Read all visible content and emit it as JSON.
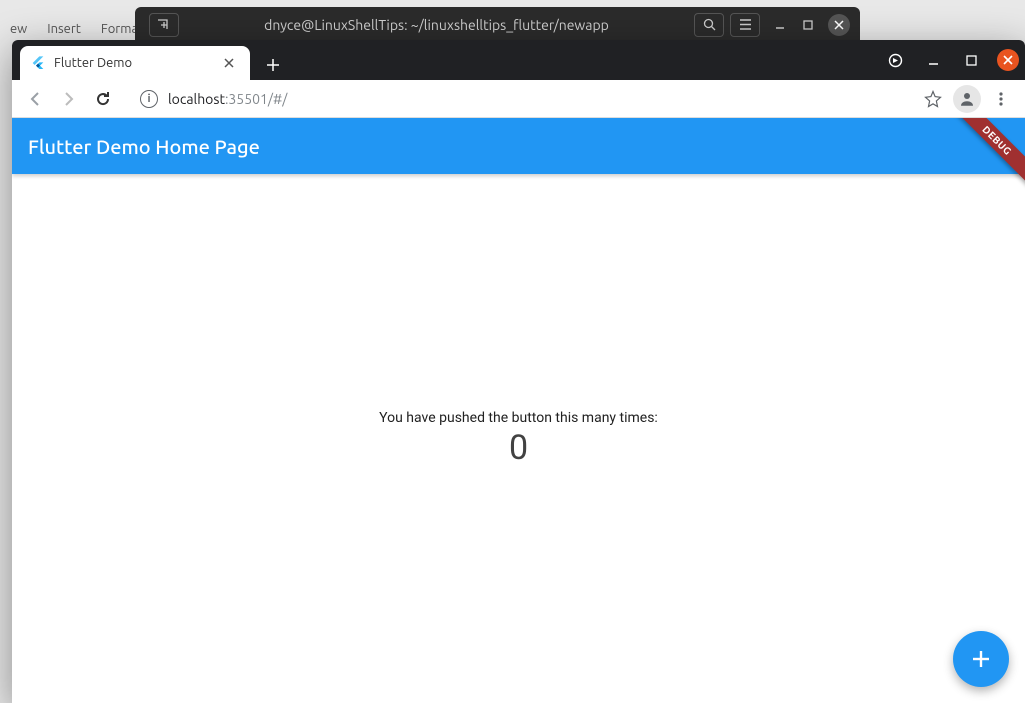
{
  "desktop": {
    "menus": [
      "ew",
      "Insert",
      "Forma"
    ]
  },
  "terminal": {
    "title": "dnyce@LinuxShellTips: ~/linuxshelltips_flutter/newapp"
  },
  "browser": {
    "tab_title": "Flutter Demo",
    "url_host": "localhost",
    "url_rest": ":35501/#/"
  },
  "flutter_app": {
    "appbar_title": "Flutter Demo Home Page",
    "debug_label": "DEBUG",
    "body_text": "You have pushed the button this many times:",
    "counter": "0"
  }
}
